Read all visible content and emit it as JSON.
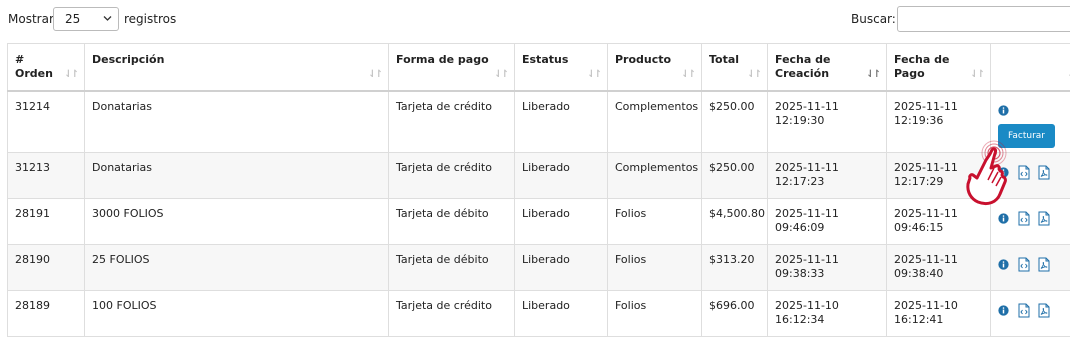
{
  "controls": {
    "show_label": "Mostrar",
    "page_size": "25",
    "records_label": "registros",
    "search_label": "Buscar:",
    "search_value": ""
  },
  "table": {
    "headers": {
      "orden": "# Orden",
      "descripcion": "Descripción",
      "forma_pago": "Forma de pago",
      "estatus": "Estatus",
      "producto": "Producto",
      "total": "Total",
      "fecha_creacion": "Fecha de Creación",
      "fecha_pago": "Fecha de Pago",
      "acciones": ""
    },
    "rows": [
      {
        "orden": "31214",
        "descripcion": "Donatarias",
        "forma_pago": "Tarjeta de crédito",
        "estatus": "Liberado",
        "producto": "Complementos",
        "total": "$250.00",
        "fecha_creacion": "2025-11-11 12:19:30",
        "fecha_pago": "2025-11-11 12:19:36"
      },
      {
        "orden": "31213",
        "descripcion": "Donatarias",
        "forma_pago": "Tarjeta de crédito",
        "estatus": "Liberado",
        "producto": "Complementos",
        "total": "$250.00",
        "fecha_creacion": "2025-11-11 12:17:23",
        "fecha_pago": "2025-11-11 12:17:29"
      },
      {
        "orden": "28191",
        "descripcion": "3000 FOLIOS",
        "forma_pago": "Tarjeta de débito",
        "estatus": "Liberado",
        "producto": "Folios",
        "total": "$4,500.80",
        "fecha_creacion": "2025-11-11 09:46:09",
        "fecha_pago": "2025-11-11 09:46:15"
      },
      {
        "orden": "28190",
        "descripcion": "25 FOLIOS",
        "forma_pago": "Tarjeta de débito",
        "estatus": "Liberado",
        "producto": "Folios",
        "total": "$313.20",
        "fecha_creacion": "2025-11-11 09:38:33",
        "fecha_pago": "2025-11-11 09:38:40"
      },
      {
        "orden": "28189",
        "descripcion": "100 FOLIOS",
        "forma_pago": "Tarjeta de crédito",
        "estatus": "Liberado",
        "producto": "Folios",
        "total": "$696.00",
        "fecha_creacion": "2025-11-10 16:12:34",
        "fecha_pago": "2025-11-10 16:12:41"
      }
    ]
  },
  "actions": {
    "facturar_label": "Facturar",
    "info_icon": "info-circle-icon",
    "xml_icon": "xml-file-icon",
    "pdf_icon": "pdf-file-icon"
  },
  "colors": {
    "accent": "#1a8ac5",
    "icon": "#1f6fa8",
    "cursor": "#c8102e"
  }
}
